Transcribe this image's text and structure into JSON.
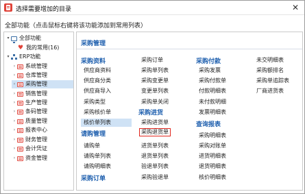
{
  "window": {
    "title": "选择需要增加的目录",
    "close_glyph": "✕"
  },
  "hint": "全部功能（点击鼠标右键将该功能添加到常用列表）",
  "tree": {
    "items": [
      {
        "label": "全部功能",
        "icon": "monitor-icon",
        "toggle": "▾"
      },
      {
        "label": "我的常用(16)",
        "icon": "heart-icon",
        "toggle": ""
      },
      {
        "label": "ERP功能",
        "icon": "network-icon",
        "toggle": "▾"
      },
      {
        "label": "系统管理",
        "icon": "folder-icon",
        "toggle": "›"
      },
      {
        "label": "仓库管理",
        "icon": "folder-icon",
        "toggle": "›"
      },
      {
        "label": "采购管理",
        "icon": "folder-icon",
        "toggle": "›",
        "selected": true
      },
      {
        "label": "销售管理",
        "icon": "folder-icon",
        "toggle": "›"
      },
      {
        "label": "生产管理",
        "icon": "folder-icon",
        "toggle": "›"
      },
      {
        "label": "条码管理",
        "icon": "folder-icon",
        "toggle": "›"
      },
      {
        "label": "质量管理",
        "icon": "folder-icon",
        "toggle": "›"
      },
      {
        "label": "报表中心",
        "icon": "folder-icon",
        "toggle": "›"
      },
      {
        "label": "财务管理",
        "icon": "folder-icon",
        "toggle": "›"
      },
      {
        "label": "会计凭证",
        "icon": "folder-icon",
        "toggle": "›"
      },
      {
        "label": "资金管理",
        "icon": "folder-icon",
        "toggle": "›"
      }
    ]
  },
  "content": {
    "header": "采购管理",
    "sections": {
      "purchase_data": "采购资料",
      "inquiry": "请购管理",
      "purchase_order_bottom": "采购订单",
      "purchase_receipt": "采购进货",
      "purchase_payment": "采购付款",
      "purchase_report": "查询报表"
    },
    "col1": [
      "供应商资料",
      "供应商分类",
      "供应商导入",
      "采购类型",
      "采购核价单",
      "核价单列表"
    ],
    "col1_inquiry": [
      "请购单",
      "请购单列表",
      "请购明细表"
    ],
    "col2_top": [
      "采购订单",
      "采购单列表",
      "采购变更单",
      "变更单列表",
      "采购单关闭"
    ],
    "col2_receipt": [
      "采购进货单",
      "采购退货单",
      "进货单列表",
      "退货单列表",
      "验退单列表",
      "采购验退单"
    ],
    "col3_payment": [
      "采购发票",
      "采购付款单",
      "付款明细表",
      "未付款明细",
      "发票明细表"
    ],
    "col3_report": [
      "采购明细表",
      "采购对账单",
      "进货明细表",
      "退货明细表",
      "核价明细表"
    ],
    "col4": [
      "未交明细表",
      "采购额排名",
      "采购单追踪表",
      "厂商进货表"
    ]
  },
  "colors": {
    "accent": "#1e5fae",
    "selection": "#cfe2f5",
    "highlight_border": "#e0241b",
    "brand_red": "#e0443a"
  }
}
